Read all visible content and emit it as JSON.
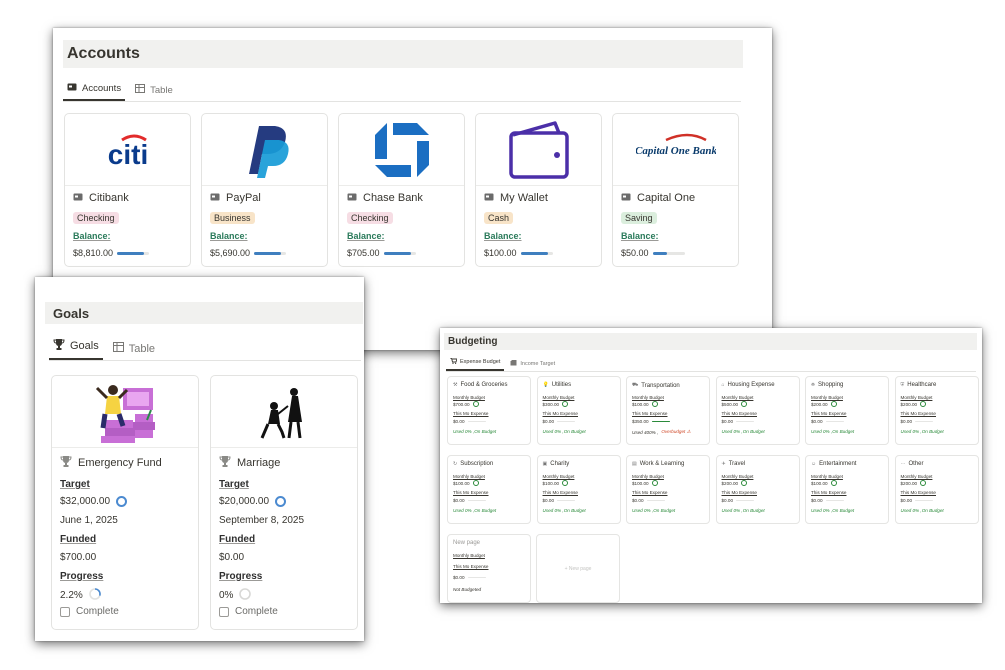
{
  "accounts": {
    "title": "Accounts",
    "tabs": [
      {
        "label": "Accounts"
      },
      {
        "label": "Table"
      }
    ],
    "balance_label": "Balance:",
    "cards": [
      {
        "name": "Citibank",
        "type": "Checking",
        "balance": "$8,810.00",
        "logo_text": "citi",
        "tag_color": "#f6dde4",
        "bar_fill": 0.85
      },
      {
        "name": "PayPal",
        "type": "Business",
        "balance": "$5,690.00",
        "logo_text": "",
        "tag_color": "#f8e4c8",
        "bar_fill": 0.85
      },
      {
        "name": "Chase Bank",
        "type": "Checking",
        "balance": "$705.00",
        "logo_text": "",
        "tag_color": "#f6dde4",
        "bar_fill": 0.85
      },
      {
        "name": "My Wallet",
        "type": "Cash",
        "balance": "$100.00",
        "logo_text": "",
        "tag_color": "#f8e4c8",
        "bar_fill": 0.85
      },
      {
        "name": "Capital One",
        "type": "Saving",
        "balance": "$50.00",
        "logo_text": "Capital One Bank",
        "tag_color": "#dbeedd",
        "bar_fill": 0.45
      }
    ]
  },
  "goals": {
    "title": "Goals",
    "tabs": [
      {
        "label": "Goals"
      },
      {
        "label": "Table"
      }
    ],
    "target_label": "Target",
    "funded_label": "Funded",
    "progress_label": "Progress",
    "complete_label": "Complete",
    "cards": [
      {
        "name": "Emergency Fund",
        "target": "$32,000.00",
        "date": "June 1, 2025",
        "funded": "$700.00",
        "progress": "2.2%",
        "progress_value": 0.022
      },
      {
        "name": "Marriage",
        "target": "$20,000.00",
        "date": "September 8, 2025",
        "funded": "$0.00",
        "progress": "0%",
        "progress_value": 0
      }
    ]
  },
  "budgeting": {
    "title": "Budgeting",
    "tabs": [
      {
        "label": "Expense Budget"
      },
      {
        "label": "Income Target"
      }
    ],
    "monthly_label": "Monthly Budget",
    "expense_label": "This Mo Expense",
    "categories": [
      {
        "name": "Food & Groceries",
        "budget": "$700.00",
        "expense": "$0.00",
        "status": "Used 0% ,On Budget",
        "over": false
      },
      {
        "name": "Utilities",
        "budget": "$300.00",
        "expense": "$0.00",
        "status": "Used 0% ,On Budget",
        "over": false
      },
      {
        "name": "Transportation",
        "budget": "$100.00",
        "expense": "$350.00",
        "status_used": "Used 400% ,",
        "status_flag": "Overbudget ⚠",
        "status": "",
        "over": true
      },
      {
        "name": "Housing Expense",
        "budget": "$500.00",
        "expense": "$0.00",
        "status": "Used 0% ,On Budget",
        "over": false
      },
      {
        "name": "Shopping",
        "budget": "$200.00",
        "expense": "$0.00",
        "status": "Used 0% ,On Budget",
        "over": false
      },
      {
        "name": "Healthcare",
        "budget": "$200.00",
        "expense": "$0.00",
        "status": "Used 0% ,On Budget",
        "over": false
      },
      {
        "name": "Subscription",
        "budget": "$100.00",
        "expense": "$0.00",
        "status": "Used 0% ,On Budget",
        "over": false
      },
      {
        "name": "Charity",
        "budget": "$100.00",
        "expense": "$0.00",
        "status": "Used 0% ,On Budget",
        "over": false
      },
      {
        "name": "Work & Learning",
        "budget": "$100.00",
        "expense": "$0.00",
        "status": "Used 0% ,On Budget",
        "over": false
      },
      {
        "name": "Travel",
        "budget": "$200.00",
        "expense": "$0.00",
        "status": "Used 0% ,On Budget",
        "over": false
      },
      {
        "name": "Entertainment",
        "budget": "$100.00",
        "expense": "$0.00",
        "status": "Used 0% ,On Budget",
        "over": false
      },
      {
        "name": "Other",
        "budget": "$200.00",
        "expense": "$0.00",
        "status": "Used 0% ,On Budget",
        "over": false
      }
    ],
    "new_page_card": {
      "name": "New page",
      "expense": "$0.00",
      "status": "Not Budgeted"
    },
    "new_page_button": "+ New page"
  }
}
